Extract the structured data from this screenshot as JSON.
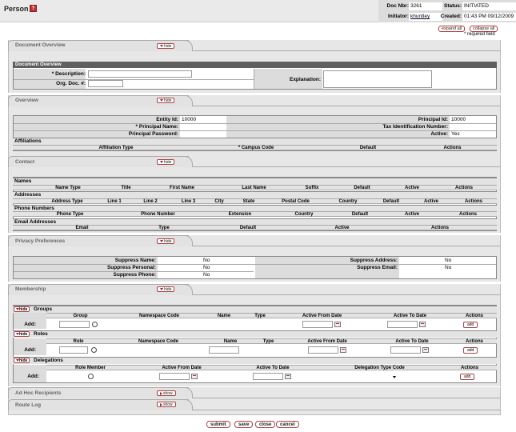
{
  "header": {
    "title": "Person",
    "help": "?",
    "doc_nbr_label": "Doc Nbr:",
    "doc_nbr": "3261",
    "status_label": "Status:",
    "status": "INITIATED",
    "initiator_label": "Initiator:",
    "initiator": "khuntley",
    "created_label": "Created:",
    "created": "01:43 PM 09/12/2009"
  },
  "controls": {
    "expand_all": "expand all",
    "collapse_all": "collapse all",
    "required_note": "* required field"
  },
  "toggle": {
    "hide": "hide",
    "show": "show"
  },
  "document_overview": {
    "tab": "Document Overview",
    "bar": "Document Overview",
    "description_label": "* Description:",
    "org_doc_label": "Org. Doc. #:",
    "explanation_label": "Explanation:"
  },
  "overview": {
    "tab": "Overview",
    "entity_id_label": "Entity Id:",
    "entity_id": "10000",
    "principal_name_label": "* Principal Name:",
    "principal_password_label": "Principal Password:",
    "principal_id_label": "Principal Id:",
    "principal_id": "10000",
    "tax_id_label": "Tax Identification Number:",
    "active_label": "Active:",
    "active": "Yes",
    "affiliations": "Affiliations",
    "affil_cols": [
      "Affiliation Type",
      "* Campus Code",
      "Default",
      "Actions"
    ]
  },
  "contact": {
    "tab": "Contact",
    "names": "Names",
    "names_cols": [
      "Name Type",
      "Title",
      "First Name",
      "Last Name",
      "Suffix",
      "Default",
      "Active",
      "Actions"
    ],
    "addresses": "Addresses",
    "addr_cols": [
      "Address Type",
      "Line 1",
      "Line 2",
      "Line 3",
      "City",
      "State",
      "Postal Code",
      "Country",
      "Default",
      "Active",
      "Actions"
    ],
    "phones": "Phone Numbers",
    "phone_cols": [
      "Phone Type",
      "Phone Number",
      "Extension",
      "Country",
      "Default",
      "Active",
      "Actions"
    ],
    "emails": "Email Addresses",
    "email_cols": [
      "Email",
      "Type",
      "Default",
      "Active",
      "Actions"
    ]
  },
  "privacy": {
    "tab": "Privacy Preferences",
    "suppress_name_label": "Suppress Name:",
    "suppress_name": "No",
    "suppress_personal_label": "Suppress Personal:",
    "suppress_personal": "No",
    "suppress_phone_label": "Suppress Phone:",
    "suppress_phone": "No",
    "suppress_address_label": "Suppress Address:",
    "suppress_address": "No",
    "suppress_email_label": "Suppress Email:",
    "suppress_email": "No"
  },
  "membership": {
    "tab": "Membership",
    "groups": "Groups",
    "group_cols": [
      "Group",
      "Namespace Code",
      "Name",
      "Type",
      "Active From Date",
      "Active To Date",
      "Actions"
    ],
    "roles": "Roles",
    "role_cols": [
      "Role",
      "Namespace Code",
      "Name",
      "Type",
      "Active From Date",
      "Active To Date",
      "Actions"
    ],
    "delegations": "Delegations",
    "deleg_cols": [
      "Role Member",
      "Active From Date",
      "Active To Date",
      "Delegation Type Code",
      "Actions"
    ],
    "add_label": "Add:",
    "add_button": "add"
  },
  "ad_hoc": {
    "tab": "Ad Hoc Recipients"
  },
  "route_log": {
    "tab": "Route Log"
  },
  "footer": {
    "submit": "submit",
    "save": "save",
    "close": "close",
    "cancel": "cancel"
  }
}
